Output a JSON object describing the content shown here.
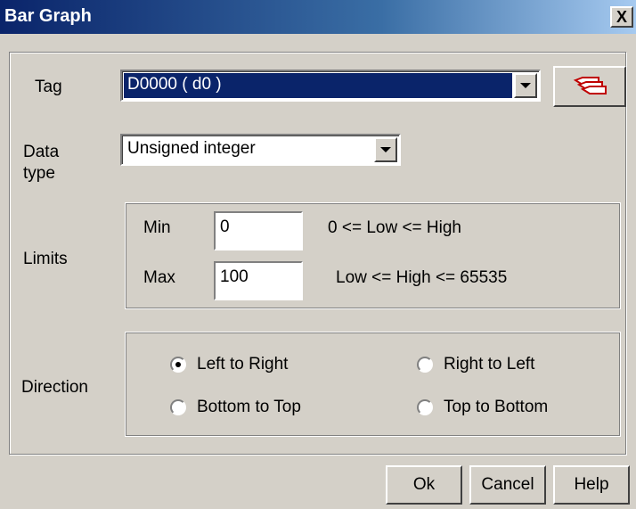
{
  "window": {
    "title": "Bar Graph",
    "close_glyph": "X"
  },
  "tag": {
    "label": "Tag",
    "value": "D0000 ( d0 )",
    "browse_icon": "tag-stack-icon"
  },
  "data_type": {
    "label_line1": "Data",
    "label_line2": "type",
    "value": "Unsigned integer"
  },
  "limits": {
    "label": "Limits",
    "min_label": "Min",
    "min_value": "0",
    "min_hint": "0 <= Low <= High",
    "max_label": "Max",
    "max_value": "100",
    "max_hint": "Low <= High <= 65535"
  },
  "direction": {
    "label": "Direction",
    "options": [
      {
        "label": "Left to Right",
        "selected": true
      },
      {
        "label": "Right to Left",
        "selected": false
      },
      {
        "label": "Bottom to Top",
        "selected": false
      },
      {
        "label": "Top to Bottom",
        "selected": false
      }
    ]
  },
  "buttons": {
    "ok": "Ok",
    "cancel": "Cancel",
    "help": "Help"
  },
  "colors": {
    "title_gradient_start": "#0a246a",
    "title_gradient_end": "#a6caf0",
    "face": "#d4d0c8",
    "selection": "#0a246a",
    "icon_red": "#c00000"
  }
}
